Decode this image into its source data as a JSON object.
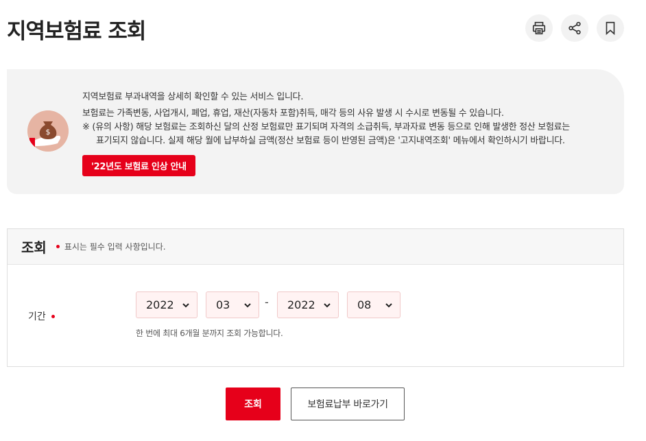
{
  "page": {
    "title": "지역보험료 조회"
  },
  "toolbar": {
    "print_icon": "print-icon",
    "share_icon": "share-icon",
    "bookmark_icon": "bookmark-icon"
  },
  "info": {
    "line1": "지역보험료 부과내역을 상세히 확인할 수 있는 서비스 입니다.",
    "line2": "보험료는 가족변동, 사업개시, 폐업, 휴업, 재산(자동차 포함)취득, 매각 등의 사유 발생 시 수시로 변동될 수 있습니다.",
    "notice_line1": "※ (유의 사항) 해당 보험료는 조회하신 달의 산정 보험료만 표기되며 자격의 소급취득, 부과자료 변동 등으로 인해 발생한 정산 보험료는",
    "notice_line2": "표기되지 않습니다. 실제 해당 월에 납부하실 금액(정산 보험료 등이 반영된 금액)은 '고지내역조회' 메뉴에서 확인하시기 바랍니다.",
    "notice_button": "'22년도 보험료 인상 안내",
    "icon": "money-bag-hand-icon"
  },
  "search": {
    "title": "조회",
    "required_note": "표시는 필수 입력 사항입니다.",
    "period_label": "기간",
    "start_year": "2022",
    "start_month": "03",
    "separator": "-",
    "end_year": "2022",
    "end_month": "08",
    "help": "한 번에 최대 6개월 분까지 조회 가능합니다."
  },
  "actions": {
    "search_button": "조회",
    "shortcut_button": "보험료납부 바로가기"
  },
  "colors": {
    "accent": "#e6001a",
    "panel_bg": "#f3f3f3",
    "select_bg": "#fff3f3"
  }
}
